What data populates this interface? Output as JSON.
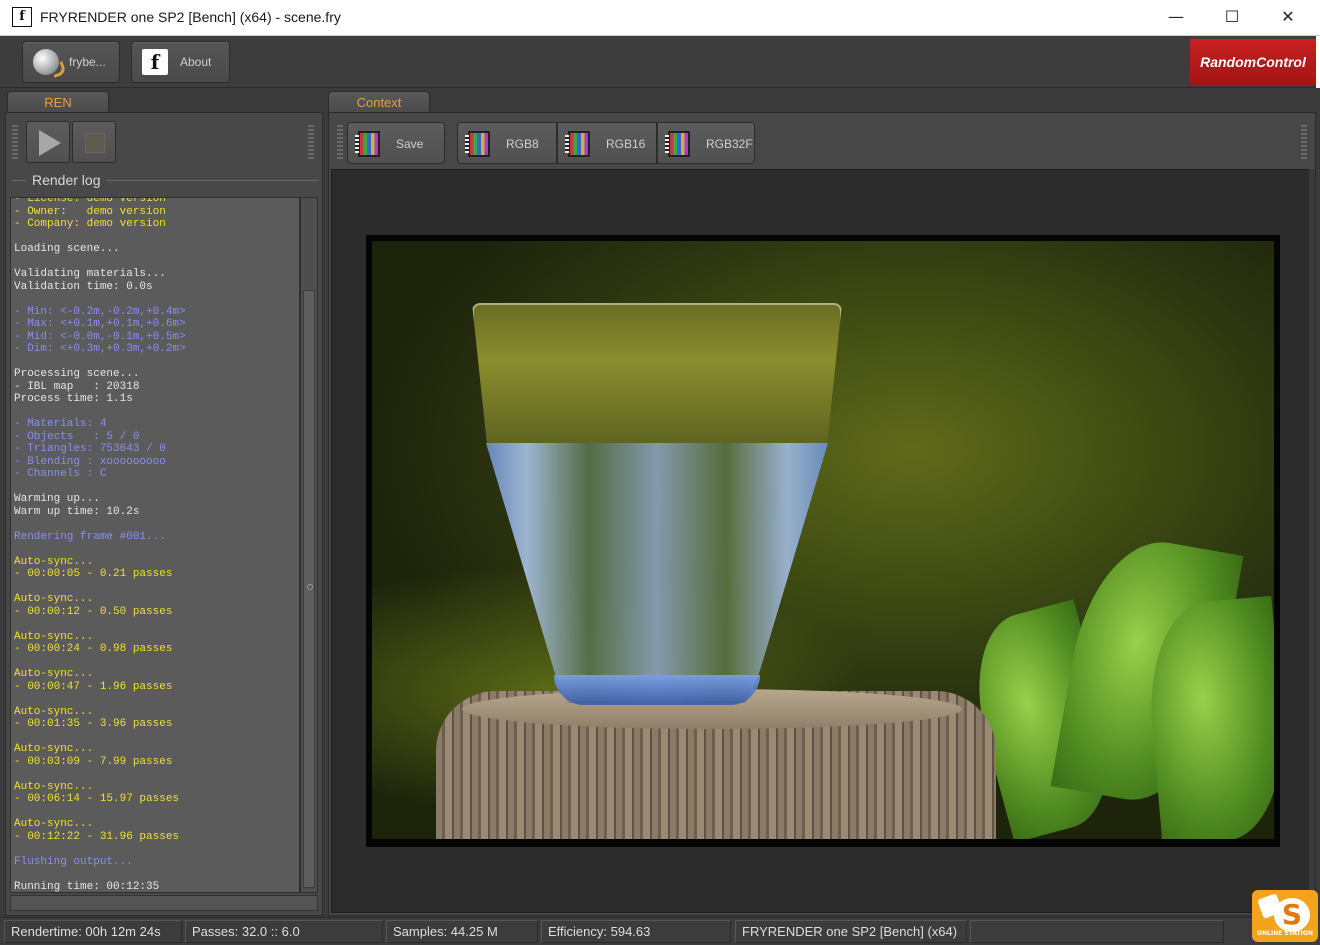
{
  "window": {
    "title": "FRYRENDER one SP2 [Bench] (x64) - scene.fry",
    "app_icon": "f",
    "minimize": "—",
    "maximize": "☐",
    "close": "✕"
  },
  "toolbar": {
    "frybench_label": "frybe...",
    "about_label": "About",
    "brand": "RandomControl"
  },
  "left_panel": {
    "tab": "REN",
    "group_label": "Render log",
    "log": [
      {
        "t": "- License: demo version",
        "c": "yellow"
      },
      {
        "t": "- Owner:   demo version",
        "c": "yellow"
      },
      {
        "t": "- Company: demo version",
        "c": "yellow"
      },
      {
        "t": "",
        "c": "white"
      },
      {
        "t": "Loading scene...",
        "c": "white"
      },
      {
        "t": "",
        "c": "white"
      },
      {
        "t": "Validating materials...",
        "c": "white"
      },
      {
        "t": "Validation time: 0.0s",
        "c": "white"
      },
      {
        "t": "",
        "c": "white"
      },
      {
        "t": "- Min: <-0.2m,-0.2m,+0.4m>",
        "c": "blue"
      },
      {
        "t": "- Max: <+0.1m,+0.1m,+0.6m>",
        "c": "blue"
      },
      {
        "t": "- Mid: <-0.0m,-0.1m,+0.5m>",
        "c": "blue"
      },
      {
        "t": "- Dim: <+0.3m,+0.3m,+0.2m>",
        "c": "blue"
      },
      {
        "t": "",
        "c": "white"
      },
      {
        "t": "Processing scene...",
        "c": "white"
      },
      {
        "t": "- IBL map   : 20318",
        "c": "white"
      },
      {
        "t": "Process time: 1.1s",
        "c": "white"
      },
      {
        "t": "",
        "c": "white"
      },
      {
        "t": "- Materials: 4",
        "c": "blue"
      },
      {
        "t": "- Objects   : 5 / 0",
        "c": "blue"
      },
      {
        "t": "- Triangles: 753643 / 0",
        "c": "blue"
      },
      {
        "t": "- Blending : xooooooooo",
        "c": "blue"
      },
      {
        "t": "- Channels : C",
        "c": "blue"
      },
      {
        "t": "",
        "c": "white"
      },
      {
        "t": "Warming up...",
        "c": "white"
      },
      {
        "t": "Warm up time: 10.2s",
        "c": "white"
      },
      {
        "t": "",
        "c": "white"
      },
      {
        "t": "Rendering frame #001...",
        "c": "blue"
      },
      {
        "t": "",
        "c": "white"
      },
      {
        "t": "Auto-sync...",
        "c": "yellow"
      },
      {
        "t": "- 00:00:05 - 0.21 passes",
        "c": "yellow"
      },
      {
        "t": "",
        "c": "white"
      },
      {
        "t": "Auto-sync...",
        "c": "yellow"
      },
      {
        "t": "- 00:00:12 - 0.50 passes",
        "c": "yellow"
      },
      {
        "t": "",
        "c": "white"
      },
      {
        "t": "Auto-sync...",
        "c": "yellow"
      },
      {
        "t": "- 00:00:24 - 0.98 passes",
        "c": "yellow"
      },
      {
        "t": "",
        "c": "white"
      },
      {
        "t": "Auto-sync...",
        "c": "yellow"
      },
      {
        "t": "- 00:00:47 - 1.96 passes",
        "c": "yellow"
      },
      {
        "t": "",
        "c": "white"
      },
      {
        "t": "Auto-sync...",
        "c": "yellow"
      },
      {
        "t": "- 00:01:35 - 3.96 passes",
        "c": "yellow"
      },
      {
        "t": "",
        "c": "white"
      },
      {
        "t": "Auto-sync...",
        "c": "yellow"
      },
      {
        "t": "- 00:03:09 - 7.99 passes",
        "c": "yellow"
      },
      {
        "t": "",
        "c": "white"
      },
      {
        "t": "Auto-sync...",
        "c": "yellow"
      },
      {
        "t": "- 00:06:14 - 15.97 passes",
        "c": "yellow"
      },
      {
        "t": "",
        "c": "white"
      },
      {
        "t": "Auto-sync...",
        "c": "yellow"
      },
      {
        "t": "- 00:12:22 - 31.96 passes",
        "c": "yellow"
      },
      {
        "t": "",
        "c": "white"
      },
      {
        "t": "Flushing output...",
        "c": "blue"
      },
      {
        "t": "",
        "c": "white"
      },
      {
        "t": "Running time: 00:12:35",
        "c": "white"
      }
    ]
  },
  "right_panel": {
    "tab": "Context",
    "save_label": "Save",
    "rgb8_label": "RGB8",
    "rgb16_label": "RGB16",
    "rgb32f_label": "RGB32F"
  },
  "status": {
    "rendertime": "Rendertime:  00h 12m 24s",
    "passes": "Passes:  32.0 :: 6.0",
    "samples": "Samples:  44.25 M",
    "efficiency": "Efficiency:  594.63",
    "product": "FRYRENDER one SP2 [Bench] (x64)"
  },
  "colors": {
    "tab_text": "#e8a040",
    "log_yellow": "#f0e030",
    "log_blue": "#8a8ff0",
    "brand_red": "#c92020"
  }
}
